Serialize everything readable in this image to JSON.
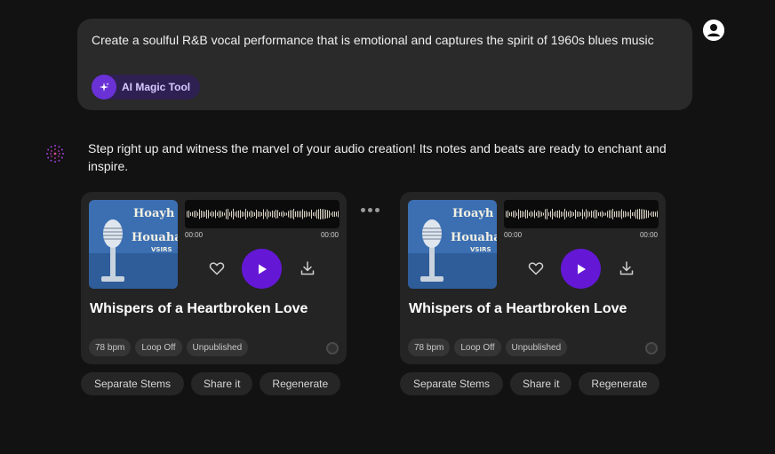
{
  "prompt": {
    "text": "Create a soulful R&B vocal performance that is emotional and captures the spirit of 1960s blues music",
    "tool_label": "AI Magic Tool",
    "tool_icon": "sparkle-icon"
  },
  "reply": {
    "text": "Step right up and witness the marvel of your audio creation! Its notes and beats are ready to enchant and inspire."
  },
  "tracks": [
    {
      "title": "Whispers of a Heartbroken Love",
      "time_start": "00:00",
      "time_end": "00:00",
      "cover_text_line1": "Hoayh",
      "cover_text_line2": "Houaha",
      "cover_text_line3": "VSIRS",
      "chips": [
        "78 bpm",
        "Loop Off",
        "Unpublished"
      ],
      "actions": [
        "Separate Stems",
        "Share it",
        "Regenerate"
      ]
    },
    {
      "title": "Whispers of a Heartbroken Love",
      "time_start": "00:00",
      "time_end": "00:00",
      "cover_text_line1": "Hoayh",
      "cover_text_line2": "Houaha",
      "cover_text_line3": "VSIRS",
      "chips": [
        "78 bpm",
        "Loop Off",
        "Unpublished"
      ],
      "actions": [
        "Separate Stems",
        "Share it",
        "Regenerate"
      ]
    }
  ],
  "colors": {
    "background": "#121212",
    "bubble": "#2a2a2a",
    "card": "#242424",
    "accent": "#6418d6",
    "pill": "#2f2052"
  }
}
